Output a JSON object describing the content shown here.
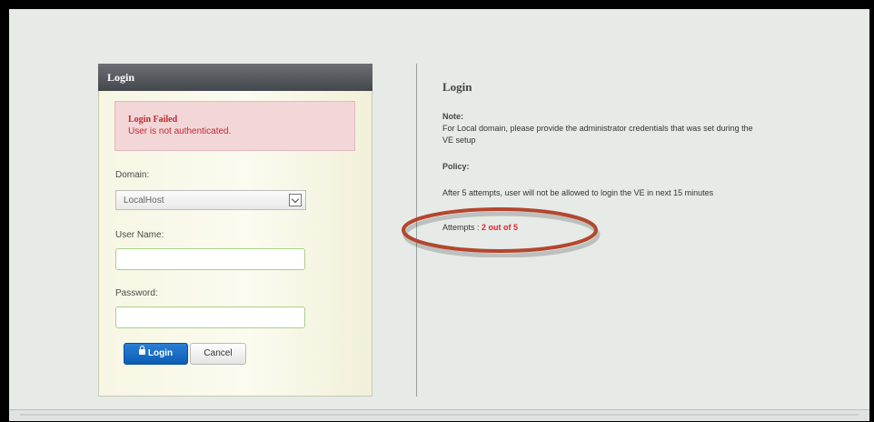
{
  "login_panel": {
    "header": "Login",
    "error_title": "Login Failed",
    "error_message": "User is not authenticated.",
    "domain_label": "Domain:",
    "domain_value": "LocalHost",
    "username_label": "User Name:",
    "username_value": "",
    "password_label": "Password:",
    "password_value": "",
    "login_button": "Login",
    "cancel_button": "Cancel"
  },
  "info": {
    "title": "Login",
    "note_label": "Note:",
    "note_text": "For Local domain, please provide the administrator credentials that was set during the VE setup",
    "policy_label": "Policy:",
    "policy_text": "After 5 attempts, user will not be allowed to login the VE in next 15 minutes",
    "attempts_label": "Attempts :",
    "attempts_value": "2 out of 5"
  },
  "colors": {
    "error_text": "#c0292d",
    "attempts_highlight": "#e0242a",
    "annotation_ellipse": "#b5462e",
    "login_button": "#0c5cb4"
  },
  "icons": {
    "login_button_icon": "lock-icon",
    "select_arrow": "chevron-down-icon"
  }
}
